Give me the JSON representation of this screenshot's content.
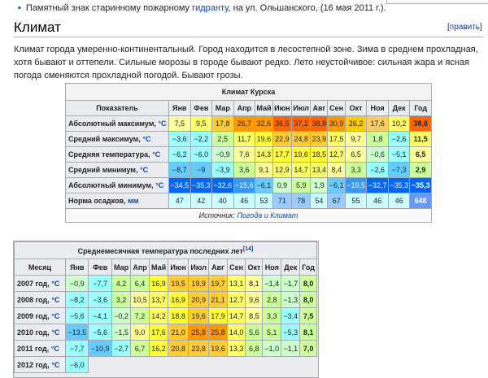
{
  "top_note": {
    "prefix": "Памятный знак старинному пожарному ",
    "link": "гидранту",
    "suffix": ", на ул. Ольшанского, (16 мая 2011 г.)."
  },
  "section": {
    "title": "Климат",
    "edit_label": "править",
    "bracket_open": "[",
    "bracket_close": "]"
  },
  "paragraph": "Климат города умеренно-континентальный. Город находится в лесостепной зоне. Зима в среднем прохладная, хотя бывают и оттепели. Сильные морозы в городе бывают редко. Лето неустойчивое: сильная жара и ясная погода сменяются прохладной погодой. Бывают грозы.",
  "climate_table": {
    "caption": "Климат Курска",
    "header_label": "Показатель",
    "months": [
      "Янв",
      "Фев",
      "Мар",
      "Апр",
      "Май",
      "Июн",
      "Июл",
      "Авг",
      "Сен",
      "Окт",
      "Ноя",
      "Дек",
      "Год"
    ],
    "rows": [
      {
        "label": "Абсолютный максимум, °C",
        "values": [
          "7,5",
          "9,5",
          "17,8",
          "26,7",
          "32,6",
          "36,5",
          "37,2",
          "38,8",
          "30,9",
          "26,2",
          "17,6",
          "10,2",
          "38,8"
        ],
        "colors": [
          "#ffff99",
          "#ffff66",
          "#ffcc33",
          "#ff9900",
          "#ff9900",
          "#ff6600",
          "#ff6600",
          "#ff6600",
          "#ff9900",
          "#ffcc00",
          "#ffcc66",
          "#ffff66",
          "#ff6600"
        ]
      },
      {
        "label": "Средний максимум, °C",
        "values": [
          "−3,6",
          "−2,2",
          "2,5",
          "11,7",
          "19,6",
          "22,9",
          "24,8",
          "23,9",
          "17,5",
          "9,7",
          "1,8",
          "−2,6",
          "11,5"
        ],
        "colors": [
          "#99ffff",
          "#99ffff",
          "#ccff99",
          "#ffff66",
          "#ffff33",
          "#ffcc33",
          "#ffcc33",
          "#ffcc33",
          "#ffff66",
          "#ffff99",
          "#ccff99",
          "#99ffff",
          "#ffff66"
        ]
      },
      {
        "label": "Средняя температура, °C",
        "values": [
          "−6,2",
          "−6,0",
          "−0,9",
          "7,6",
          "14,3",
          "17,7",
          "19,6",
          "18,5",
          "12,7",
          "6,5",
          "−0,6",
          "−5,1",
          "6,5"
        ],
        "colors": [
          "#99ffff",
          "#99ffff",
          "#ccffcc",
          "#ffff99",
          "#ffff66",
          "#ffff33",
          "#ffff33",
          "#ffff33",
          "#ffff66",
          "#ffff99",
          "#ccffcc",
          "#99ffff",
          "#ffff99"
        ]
      },
      {
        "label": "Средний минимум, °C",
        "values": [
          "−8,7",
          "−9",
          "−3,9",
          "3,6",
          "9,1",
          "12,9",
          "14,7",
          "13,4",
          "8,4",
          "3,3",
          "−2,6",
          "−7,3",
          "2,9"
        ],
        "colors": [
          "#66ccff",
          "#66ccff",
          "#99ffff",
          "#ccff99",
          "#ffff99",
          "#ffff66",
          "#ffff66",
          "#ffff66",
          "#ffff99",
          "#ccff99",
          "#99ffff",
          "#66ccff",
          "#ccff99"
        ]
      },
      {
        "label": "Абсолютный минимум, °C",
        "values": [
          "−34,5",
          "−35,3",
          "−32,6",
          "−15,6",
          "−6,1",
          "0,9",
          "5,9",
          "1,9",
          "−6,1",
          "−19,5",
          "−32,7",
          "−35,3",
          "−35,3"
        ],
        "colors": [
          "#0066ff",
          "#0066ff",
          "#0066ff",
          "#3399ff",
          "#66ccff",
          "#ccffcc",
          "#ccff99",
          "#ccffcc",
          "#66ccff",
          "#3399ff",
          "#0066ff",
          "#0066ff",
          "#0066ff"
        ]
      },
      {
        "label": "Норма осадков, мм",
        "values": [
          "47",
          "42",
          "40",
          "46",
          "53",
          "71",
          "78",
          "54",
          "67",
          "55",
          "46",
          "46",
          "648"
        ],
        "colors": [
          "#ccffff",
          "#ccffff",
          "#ccffff",
          "#ccffff",
          "#ccffff",
          "#99ccff",
          "#99ccff",
          "#ccffff",
          "#99ccff",
          "#ccffff",
          "#ccffff",
          "#ccffff",
          "#6699ff"
        ]
      }
    ],
    "source_label": "Источник:",
    "source_link": "Погода и Климат"
  },
  "monthly_table": {
    "caption": "Среднемесячная температура последних лет",
    "ref": "[14]",
    "header_label": "Месяц",
    "months": [
      "Янв",
      "Фев",
      "Мар",
      "Апр",
      "Май",
      "Июн",
      "Июл",
      "Авг",
      "Сен",
      "Окт",
      "Ноя",
      "Дек",
      "Год"
    ],
    "rows": [
      {
        "label": "2007 год, °C",
        "values": [
          "−0,9",
          "−7,7",
          "4,2",
          "6,4",
          "16,9",
          "19,5",
          "19,9",
          "19,7",
          "13,1",
          "8,1",
          "−1,4",
          "−1,7",
          "8,0"
        ],
        "colors": [
          "#ccffcc",
          "#99ffff",
          "#ccff99",
          "#ccff99",
          "#ffff33",
          "#ffcc33",
          "#ffcc33",
          "#ffcc33",
          "#ffff66",
          "#ffff99",
          "#ccffcc",
          "#ccffcc",
          "#ccff99"
        ]
      },
      {
        "label": "2008 год, °C",
        "values": [
          "−8,2",
          "−3,6",
          "3,2",
          "10,5",
          "13,7",
          "16,9",
          "20,9",
          "21,1",
          "12,7",
          "9,6",
          "2,8",
          "−1,3",
          "8,0"
        ],
        "colors": [
          "#99ffff",
          "#99ffff",
          "#ccff99",
          "#ffff99",
          "#ffff66",
          "#ffff33",
          "#ffcc33",
          "#ffcc33",
          "#ffff66",
          "#ffff99",
          "#ccff99",
          "#ccffcc",
          "#ccff99"
        ]
      },
      {
        "label": "2009 год, °C",
        "values": [
          "−5,6",
          "−4,1",
          "−0,2",
          "7,2",
          "14,2",
          "18,8",
          "19,6",
          "17,9",
          "14,7",
          "8,5",
          "3,3",
          "−3,4",
          "7,5"
        ],
        "colors": [
          "#99ffff",
          "#99ffff",
          "#ccffcc",
          "#ccff99",
          "#ffff66",
          "#ffff33",
          "#ffcc33",
          "#ffff33",
          "#ffff66",
          "#ffff99",
          "#ccff99",
          "#99ffff",
          "#ccff99"
        ]
      },
      {
        "label": "2010 год, °C",
        "values": [
          "−13,5",
          "−5,6",
          "−1,5",
          "9,0",
          "17,6",
          "21,0",
          "25,8",
          "25,8",
          "14,0",
          "5,6",
          "5,1",
          "−5,3",
          "8,1"
        ],
        "colors": [
          "#66ccff",
          "#99ffff",
          "#ccffcc",
          "#ffff99",
          "#ffff33",
          "#ffcc33",
          "#ff9900",
          "#ff9900",
          "#ffff66",
          "#ccff99",
          "#ccff99",
          "#99ffff",
          "#ccff99"
        ]
      },
      {
        "label": "2011 год, °C",
        "values": [
          "−7,7",
          "−10,9",
          "−2,7",
          "6,7",
          "16,2",
          "20,8",
          "23,8",
          "19,6",
          "13,3",
          "6,8",
          "−1,0",
          "−1,1",
          "7,0"
        ],
        "colors": [
          "#99ffff",
          "#66ccff",
          "#99ffff",
          "#ccff99",
          "#ffff33",
          "#ffcc33",
          "#ffcc33",
          "#ffcc33",
          "#ffff66",
          "#ccff99",
          "#ccffcc",
          "#ccffcc",
          "#ccff99"
        ]
      },
      {
        "label": "2012 год, °C",
        "values": [
          "−6,0"
        ],
        "colors": [
          "#99ffff"
        ]
      }
    ]
  }
}
